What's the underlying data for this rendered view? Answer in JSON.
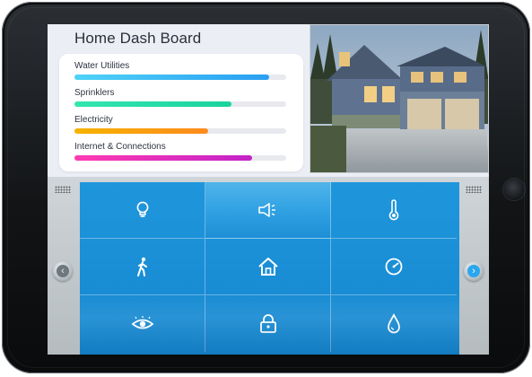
{
  "dashboard": {
    "title": "Home Dash Board",
    "metrics": [
      {
        "label": "Water Utilities",
        "level": 0.92,
        "color_from": "#4fd3f7",
        "color_to": "#2a9ff2"
      },
      {
        "label": "Sprinklers",
        "level": 0.74,
        "color_from": "#33e6b0",
        "color_to": "#17d39c"
      },
      {
        "label": "Electricity",
        "level": 0.63,
        "color_from": "#f5b301",
        "color_to": "#ff8a1f"
      },
      {
        "label": "Internet & Connections",
        "level": 0.84,
        "color_from": "#ff3bb2",
        "color_to": "#c323c7"
      }
    ]
  },
  "house_photo": {
    "alt": "house-photo"
  },
  "controls": {
    "tiles": [
      {
        "icon": "light-bulb-icon",
        "state": "normal"
      },
      {
        "icon": "speaker-icon",
        "state": "active"
      },
      {
        "icon": "thermometer-icon",
        "state": "normal"
      },
      {
        "icon": "walking-person-icon",
        "state": "normal"
      },
      {
        "icon": "home-icon",
        "state": "normal"
      },
      {
        "icon": "gauge-icon",
        "state": "normal"
      },
      {
        "icon": "eye-icon",
        "state": "normal"
      },
      {
        "icon": "lock-icon",
        "state": "normal"
      },
      {
        "icon": "water-drop-icon",
        "state": "normal"
      }
    ],
    "nav": {
      "prev_icon": "chevron-left-icon",
      "next_icon": "chevron-right-icon"
    }
  },
  "colors": {
    "panel_blue": "#1f96dc",
    "active_tile": "#4fb4ea",
    "device_frame": "#141618"
  }
}
